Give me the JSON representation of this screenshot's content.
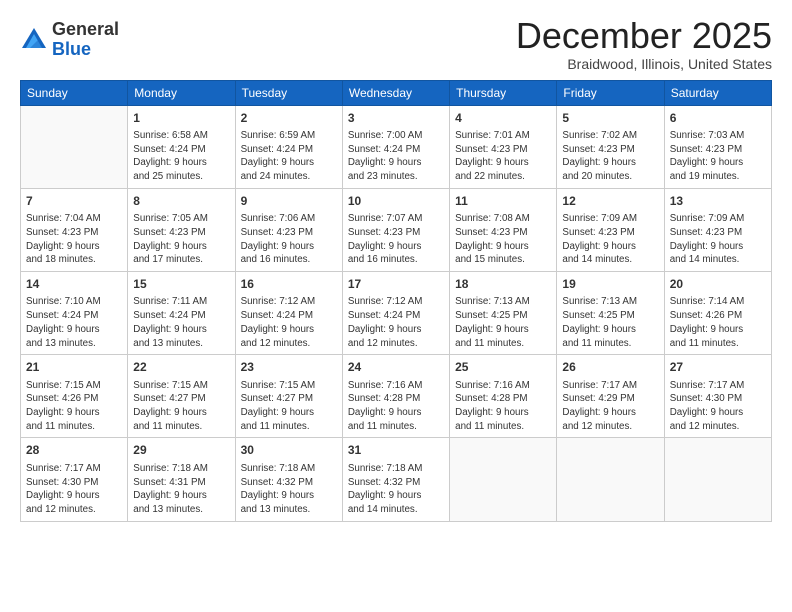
{
  "header": {
    "logo_general": "General",
    "logo_blue": "Blue",
    "month_title": "December 2025",
    "location": "Braidwood, Illinois, United States"
  },
  "days_of_week": [
    "Sunday",
    "Monday",
    "Tuesday",
    "Wednesday",
    "Thursday",
    "Friday",
    "Saturday"
  ],
  "weeks": [
    [
      {
        "day": "",
        "info": ""
      },
      {
        "day": "1",
        "info": "Sunrise: 6:58 AM\nSunset: 4:24 PM\nDaylight: 9 hours\nand 25 minutes."
      },
      {
        "day": "2",
        "info": "Sunrise: 6:59 AM\nSunset: 4:24 PM\nDaylight: 9 hours\nand 24 minutes."
      },
      {
        "day": "3",
        "info": "Sunrise: 7:00 AM\nSunset: 4:24 PM\nDaylight: 9 hours\nand 23 minutes."
      },
      {
        "day": "4",
        "info": "Sunrise: 7:01 AM\nSunset: 4:23 PM\nDaylight: 9 hours\nand 22 minutes."
      },
      {
        "day": "5",
        "info": "Sunrise: 7:02 AM\nSunset: 4:23 PM\nDaylight: 9 hours\nand 20 minutes."
      },
      {
        "day": "6",
        "info": "Sunrise: 7:03 AM\nSunset: 4:23 PM\nDaylight: 9 hours\nand 19 minutes."
      }
    ],
    [
      {
        "day": "7",
        "info": "Sunrise: 7:04 AM\nSunset: 4:23 PM\nDaylight: 9 hours\nand 18 minutes."
      },
      {
        "day": "8",
        "info": "Sunrise: 7:05 AM\nSunset: 4:23 PM\nDaylight: 9 hours\nand 17 minutes."
      },
      {
        "day": "9",
        "info": "Sunrise: 7:06 AM\nSunset: 4:23 PM\nDaylight: 9 hours\nand 16 minutes."
      },
      {
        "day": "10",
        "info": "Sunrise: 7:07 AM\nSunset: 4:23 PM\nDaylight: 9 hours\nand 16 minutes."
      },
      {
        "day": "11",
        "info": "Sunrise: 7:08 AM\nSunset: 4:23 PM\nDaylight: 9 hours\nand 15 minutes."
      },
      {
        "day": "12",
        "info": "Sunrise: 7:09 AM\nSunset: 4:23 PM\nDaylight: 9 hours\nand 14 minutes."
      },
      {
        "day": "13",
        "info": "Sunrise: 7:09 AM\nSunset: 4:23 PM\nDaylight: 9 hours\nand 14 minutes."
      }
    ],
    [
      {
        "day": "14",
        "info": "Sunrise: 7:10 AM\nSunset: 4:24 PM\nDaylight: 9 hours\nand 13 minutes."
      },
      {
        "day": "15",
        "info": "Sunrise: 7:11 AM\nSunset: 4:24 PM\nDaylight: 9 hours\nand 13 minutes."
      },
      {
        "day": "16",
        "info": "Sunrise: 7:12 AM\nSunset: 4:24 PM\nDaylight: 9 hours\nand 12 minutes."
      },
      {
        "day": "17",
        "info": "Sunrise: 7:12 AM\nSunset: 4:24 PM\nDaylight: 9 hours\nand 12 minutes."
      },
      {
        "day": "18",
        "info": "Sunrise: 7:13 AM\nSunset: 4:25 PM\nDaylight: 9 hours\nand 11 minutes."
      },
      {
        "day": "19",
        "info": "Sunrise: 7:13 AM\nSunset: 4:25 PM\nDaylight: 9 hours\nand 11 minutes."
      },
      {
        "day": "20",
        "info": "Sunrise: 7:14 AM\nSunset: 4:26 PM\nDaylight: 9 hours\nand 11 minutes."
      }
    ],
    [
      {
        "day": "21",
        "info": "Sunrise: 7:15 AM\nSunset: 4:26 PM\nDaylight: 9 hours\nand 11 minutes."
      },
      {
        "day": "22",
        "info": "Sunrise: 7:15 AM\nSunset: 4:27 PM\nDaylight: 9 hours\nand 11 minutes."
      },
      {
        "day": "23",
        "info": "Sunrise: 7:15 AM\nSunset: 4:27 PM\nDaylight: 9 hours\nand 11 minutes."
      },
      {
        "day": "24",
        "info": "Sunrise: 7:16 AM\nSunset: 4:28 PM\nDaylight: 9 hours\nand 11 minutes."
      },
      {
        "day": "25",
        "info": "Sunrise: 7:16 AM\nSunset: 4:28 PM\nDaylight: 9 hours\nand 11 minutes."
      },
      {
        "day": "26",
        "info": "Sunrise: 7:17 AM\nSunset: 4:29 PM\nDaylight: 9 hours\nand 12 minutes."
      },
      {
        "day": "27",
        "info": "Sunrise: 7:17 AM\nSunset: 4:30 PM\nDaylight: 9 hours\nand 12 minutes."
      }
    ],
    [
      {
        "day": "28",
        "info": "Sunrise: 7:17 AM\nSunset: 4:30 PM\nDaylight: 9 hours\nand 12 minutes."
      },
      {
        "day": "29",
        "info": "Sunrise: 7:18 AM\nSunset: 4:31 PM\nDaylight: 9 hours\nand 13 minutes."
      },
      {
        "day": "30",
        "info": "Sunrise: 7:18 AM\nSunset: 4:32 PM\nDaylight: 9 hours\nand 13 minutes."
      },
      {
        "day": "31",
        "info": "Sunrise: 7:18 AM\nSunset: 4:32 PM\nDaylight: 9 hours\nand 14 minutes."
      },
      {
        "day": "",
        "info": ""
      },
      {
        "day": "",
        "info": ""
      },
      {
        "day": "",
        "info": ""
      }
    ]
  ]
}
